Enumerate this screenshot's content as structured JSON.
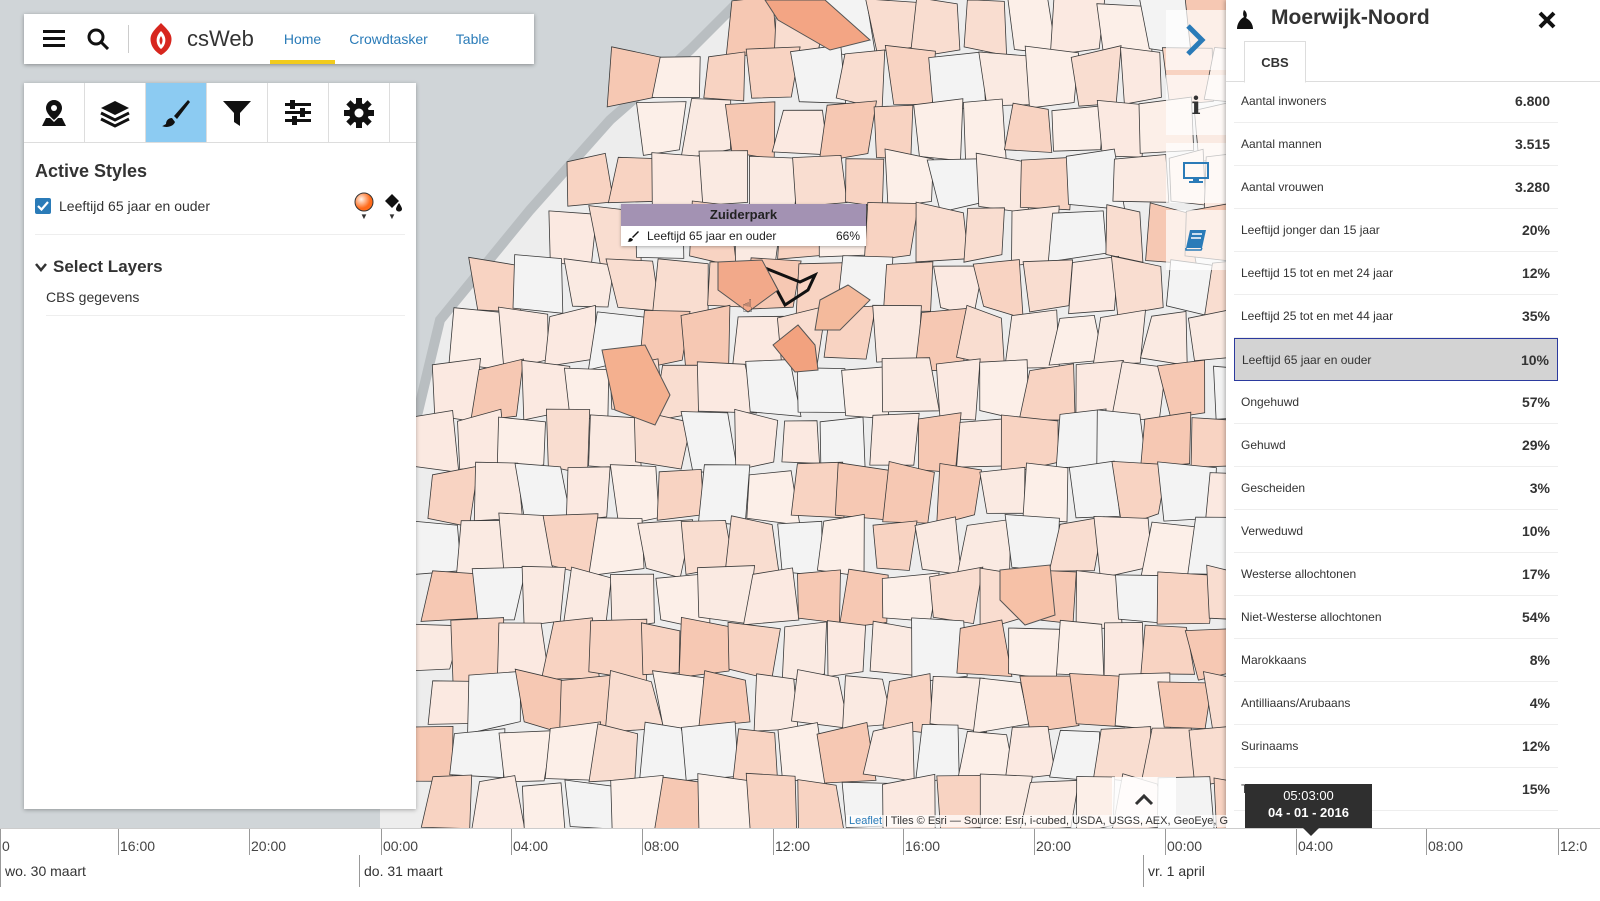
{
  "app": {
    "brand": "csWeb",
    "nav": [
      {
        "label": "Home",
        "active": true
      },
      {
        "label": "Crowdtasker",
        "active": false
      },
      {
        "label": "Table",
        "active": false
      }
    ]
  },
  "left_panel": {
    "tools": [
      "map-pin-icon",
      "layers-icon",
      "brush-icon",
      "filter-icon",
      "sliders-icon",
      "gear-icon"
    ],
    "active_tool": "brush-icon",
    "active_styles_title": "Active Styles",
    "style_item": {
      "label": "Leeftijd 65 jaar en ouder",
      "checked": true
    },
    "select_layers_title": "Select Layers",
    "layer_item": "CBS gegevens"
  },
  "tooltip": {
    "title": "Zuiderpark",
    "label": "Leeftijd 65 jaar en ouder",
    "value": "66%"
  },
  "right_panel": {
    "title": "Moerwijk-Noord",
    "tab": "CBS",
    "rows": [
      {
        "label": "Aantal inwoners",
        "value": "6.800"
      },
      {
        "label": "Aantal mannen",
        "value": "3.515"
      },
      {
        "label": "Aantal vrouwen",
        "value": "3.280"
      },
      {
        "label": "Leeftijd jonger dan 15 jaar",
        "value": "20%"
      },
      {
        "label": "Leeftijd 15 tot en met 24 jaar",
        "value": "12%"
      },
      {
        "label": "Leeftijd 25 tot en met 44 jaar",
        "value": "35%"
      },
      {
        "label": "Leeftijd 65 jaar en ouder",
        "value": "10%"
      },
      {
        "label": "Ongehuwd",
        "value": "57%"
      },
      {
        "label": "Gehuwd",
        "value": "29%"
      },
      {
        "label": "Gescheiden",
        "value": "3%"
      },
      {
        "label": "Verweduwd",
        "value": "10%"
      },
      {
        "label": "Westerse allochtonen",
        "value": "17%"
      },
      {
        "label": "Niet-Westerse allochtonen",
        "value": "54%"
      },
      {
        "label": "Marokkaans",
        "value": "8%"
      },
      {
        "label": "Antilliaans/Arubaans",
        "value": "4%"
      },
      {
        "label": "Surinaams",
        "value": "12%"
      },
      {
        "label": "T",
        "value": "15%"
      }
    ],
    "selected_row": 6
  },
  "timeline": {
    "hours": [
      "0",
      "16:00",
      "20:00",
      "00:00",
      "04:00",
      "08:00",
      "12:00",
      "16:00",
      "20:00",
      "00:00",
      "04:00",
      "08:00",
      "12:0"
    ],
    "days": [
      "wo. 30 maart",
      "do. 31 maart",
      "vr. 1 april"
    ],
    "cursor_time": "05:03:00",
    "cursor_date": "04 - 01 - 2016"
  },
  "attribution": {
    "link": "Leaflet",
    "text": " | Tiles © Esri — Source: Esri, i-cubed, USDA, USGS, AEX, GeoEye, Ge"
  },
  "colors": {
    "accent": "#2a7bb8",
    "nav_underline": "#f1cb1d",
    "active_tool": "#8ccbf2",
    "tooltip_header": "#a392b3",
    "choropleth_light": "#fbe9e1",
    "choropleth_dark": "#f0a079"
  }
}
